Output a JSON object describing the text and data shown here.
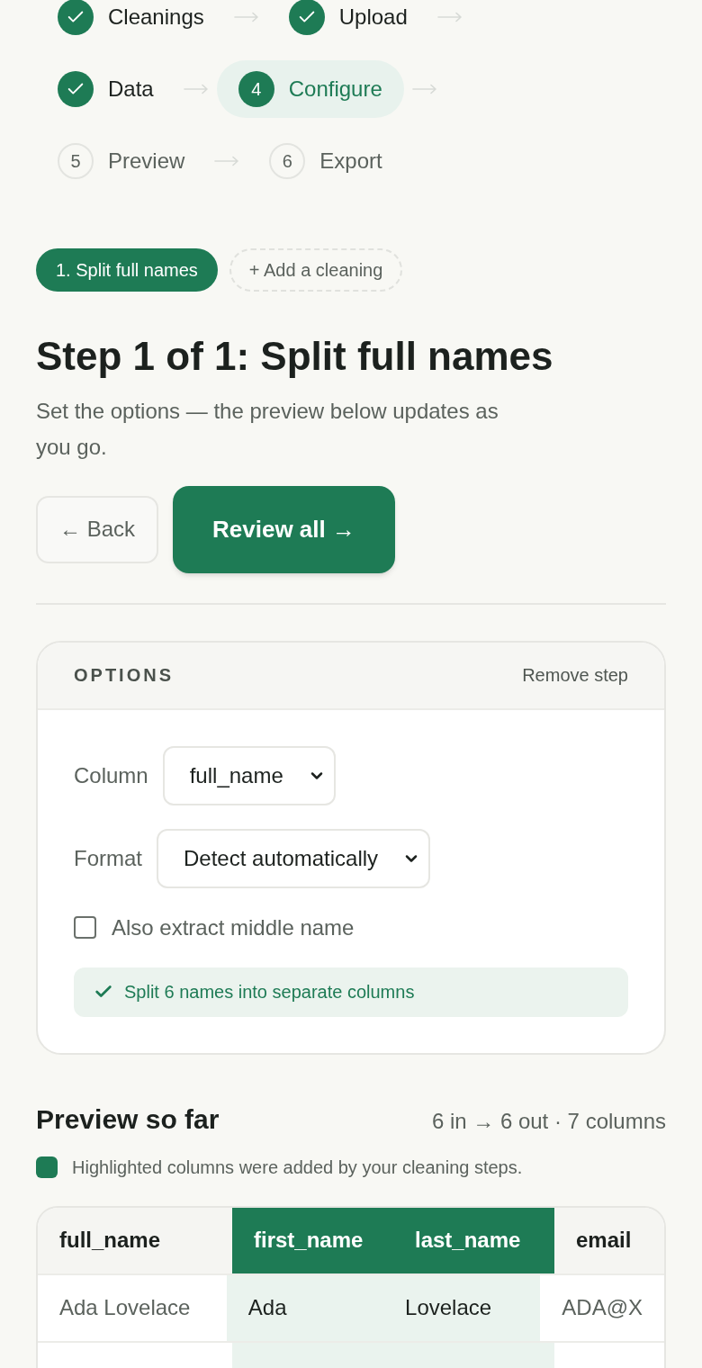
{
  "stepper": [
    {
      "label": "Cleanings",
      "done": true,
      "selected": false
    },
    {
      "label": "Upload",
      "done": true,
      "selected": false
    },
    {
      "label": "Data",
      "done": true,
      "selected": false
    },
    {
      "label": "Configure",
      "number": "4",
      "done": false,
      "selected": true
    },
    {
      "label": "Preview",
      "number": "5",
      "done": false,
      "selected": false
    },
    {
      "label": "Export",
      "number": "6",
      "done": false,
      "selected": false
    }
  ],
  "cleanings": {
    "items": [
      {
        "label": "1. Split full names",
        "selected": true
      }
    ],
    "add_button": "+ Add a cleaning"
  },
  "step": {
    "title": "Step 1 of 1: Split full names",
    "subtitle": "Set the options — the preview below updates as you go.",
    "back_button": "← Back",
    "next_button": "Review all →"
  },
  "options": {
    "title": "OPTIONS",
    "remove_button": "Remove step",
    "fields": [
      {
        "kind": "select",
        "label": "Column",
        "value": "full_name"
      },
      {
        "kind": "select",
        "label": "Format",
        "value": "Detect automatically"
      },
      {
        "kind": "checkbox",
        "label": "Also extract middle name",
        "checked": false
      }
    ],
    "status": "Split 6 names into separate columns"
  },
  "preview": {
    "title": "Preview so far",
    "summary": "6 in → 6 out · 7 columns",
    "legend": "Highlighted columns were added by your cleaning steps.",
    "table": {
      "columns": [
        {
          "label": "full_name",
          "added": false
        },
        {
          "label": "first_name",
          "added": true
        },
        {
          "label": "last_name",
          "added": true
        },
        {
          "label": "email",
          "added": false
        }
      ],
      "rows": [
        [
          "Ada Lovelace",
          "Ada",
          "Lovelace",
          "ADA@X"
        ]
      ]
    }
  }
}
